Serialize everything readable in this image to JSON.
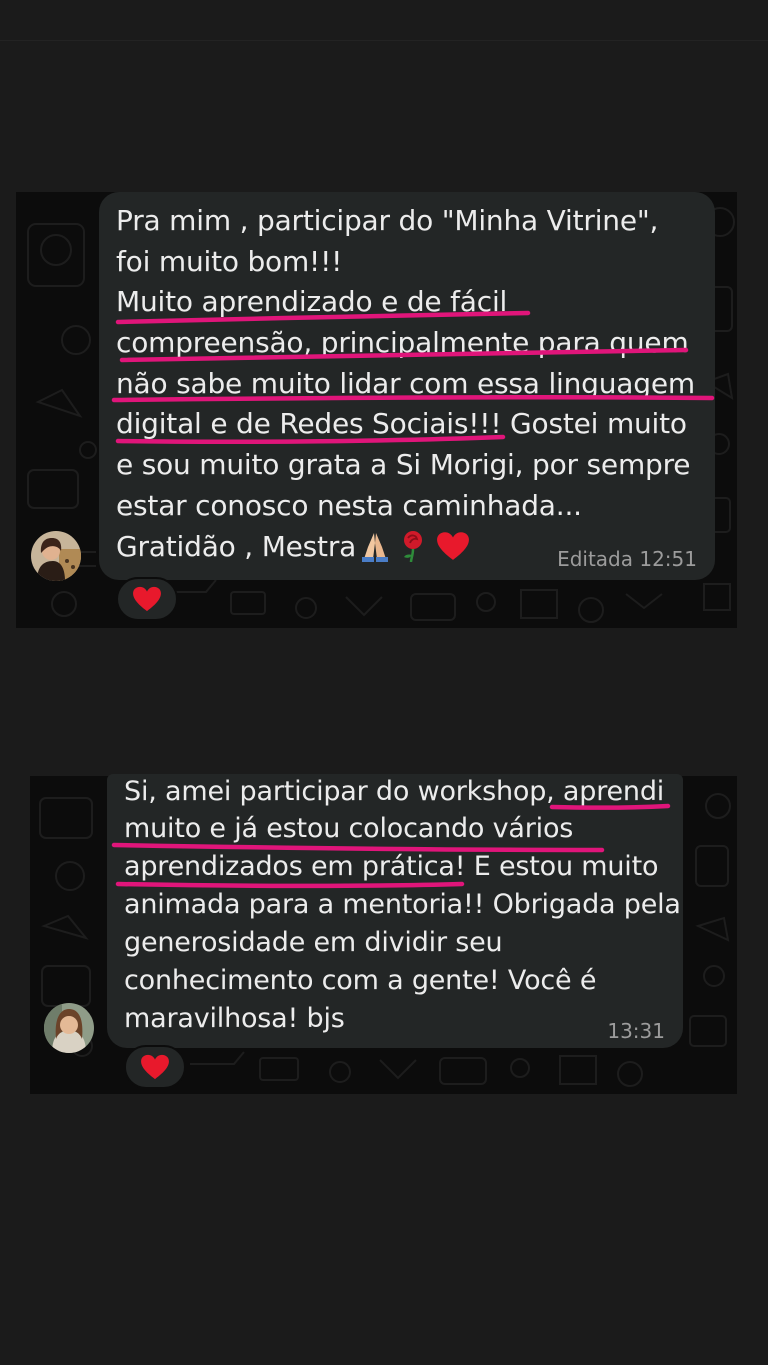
{
  "messages": [
    {
      "lines": [
        "Pra mim , participar do \"Minha  Vitrine\",",
        "foi muito bom!!!",
        "Muito aprendizado e de fácil",
        "compreensão, principalmente para quem",
        "não sabe muito lidar com essa linguagem",
        "digital e de Redes Sociais!!! Gostei muito",
        "e sou muito grata a Si Morigi, por sempre",
        "estar conosco nesta caminhada...",
        "Gratidão , Mestra"
      ],
      "emoji_after_last_line": [
        "folded-hands-icon",
        "rose-icon",
        "red-heart-icon"
      ],
      "meta": "Editada 12:51",
      "reaction": "red-heart-icon"
    },
    {
      "lines": [
        "Si, amei participar do workshop, aprendi",
        "muito e já estou colocando vários",
        "aprendizados em  prática! E estou muito",
        "animada para a mentoria!! Obrigada pela",
        "generosidade em dividir seu",
        "conhecimento com a gente! Você é",
        "maravilhosa! bjs"
      ],
      "meta": "13:31",
      "reaction": "red-heart-icon"
    }
  ],
  "colors": {
    "page_background": "#1b1b1b",
    "chat_background": "#0c0c0c",
    "bubble": "#232626",
    "text": "#ececec",
    "meta_text": "#9c9c9c",
    "highlight_underline": "#e0157a",
    "heart": "#e8192c"
  }
}
